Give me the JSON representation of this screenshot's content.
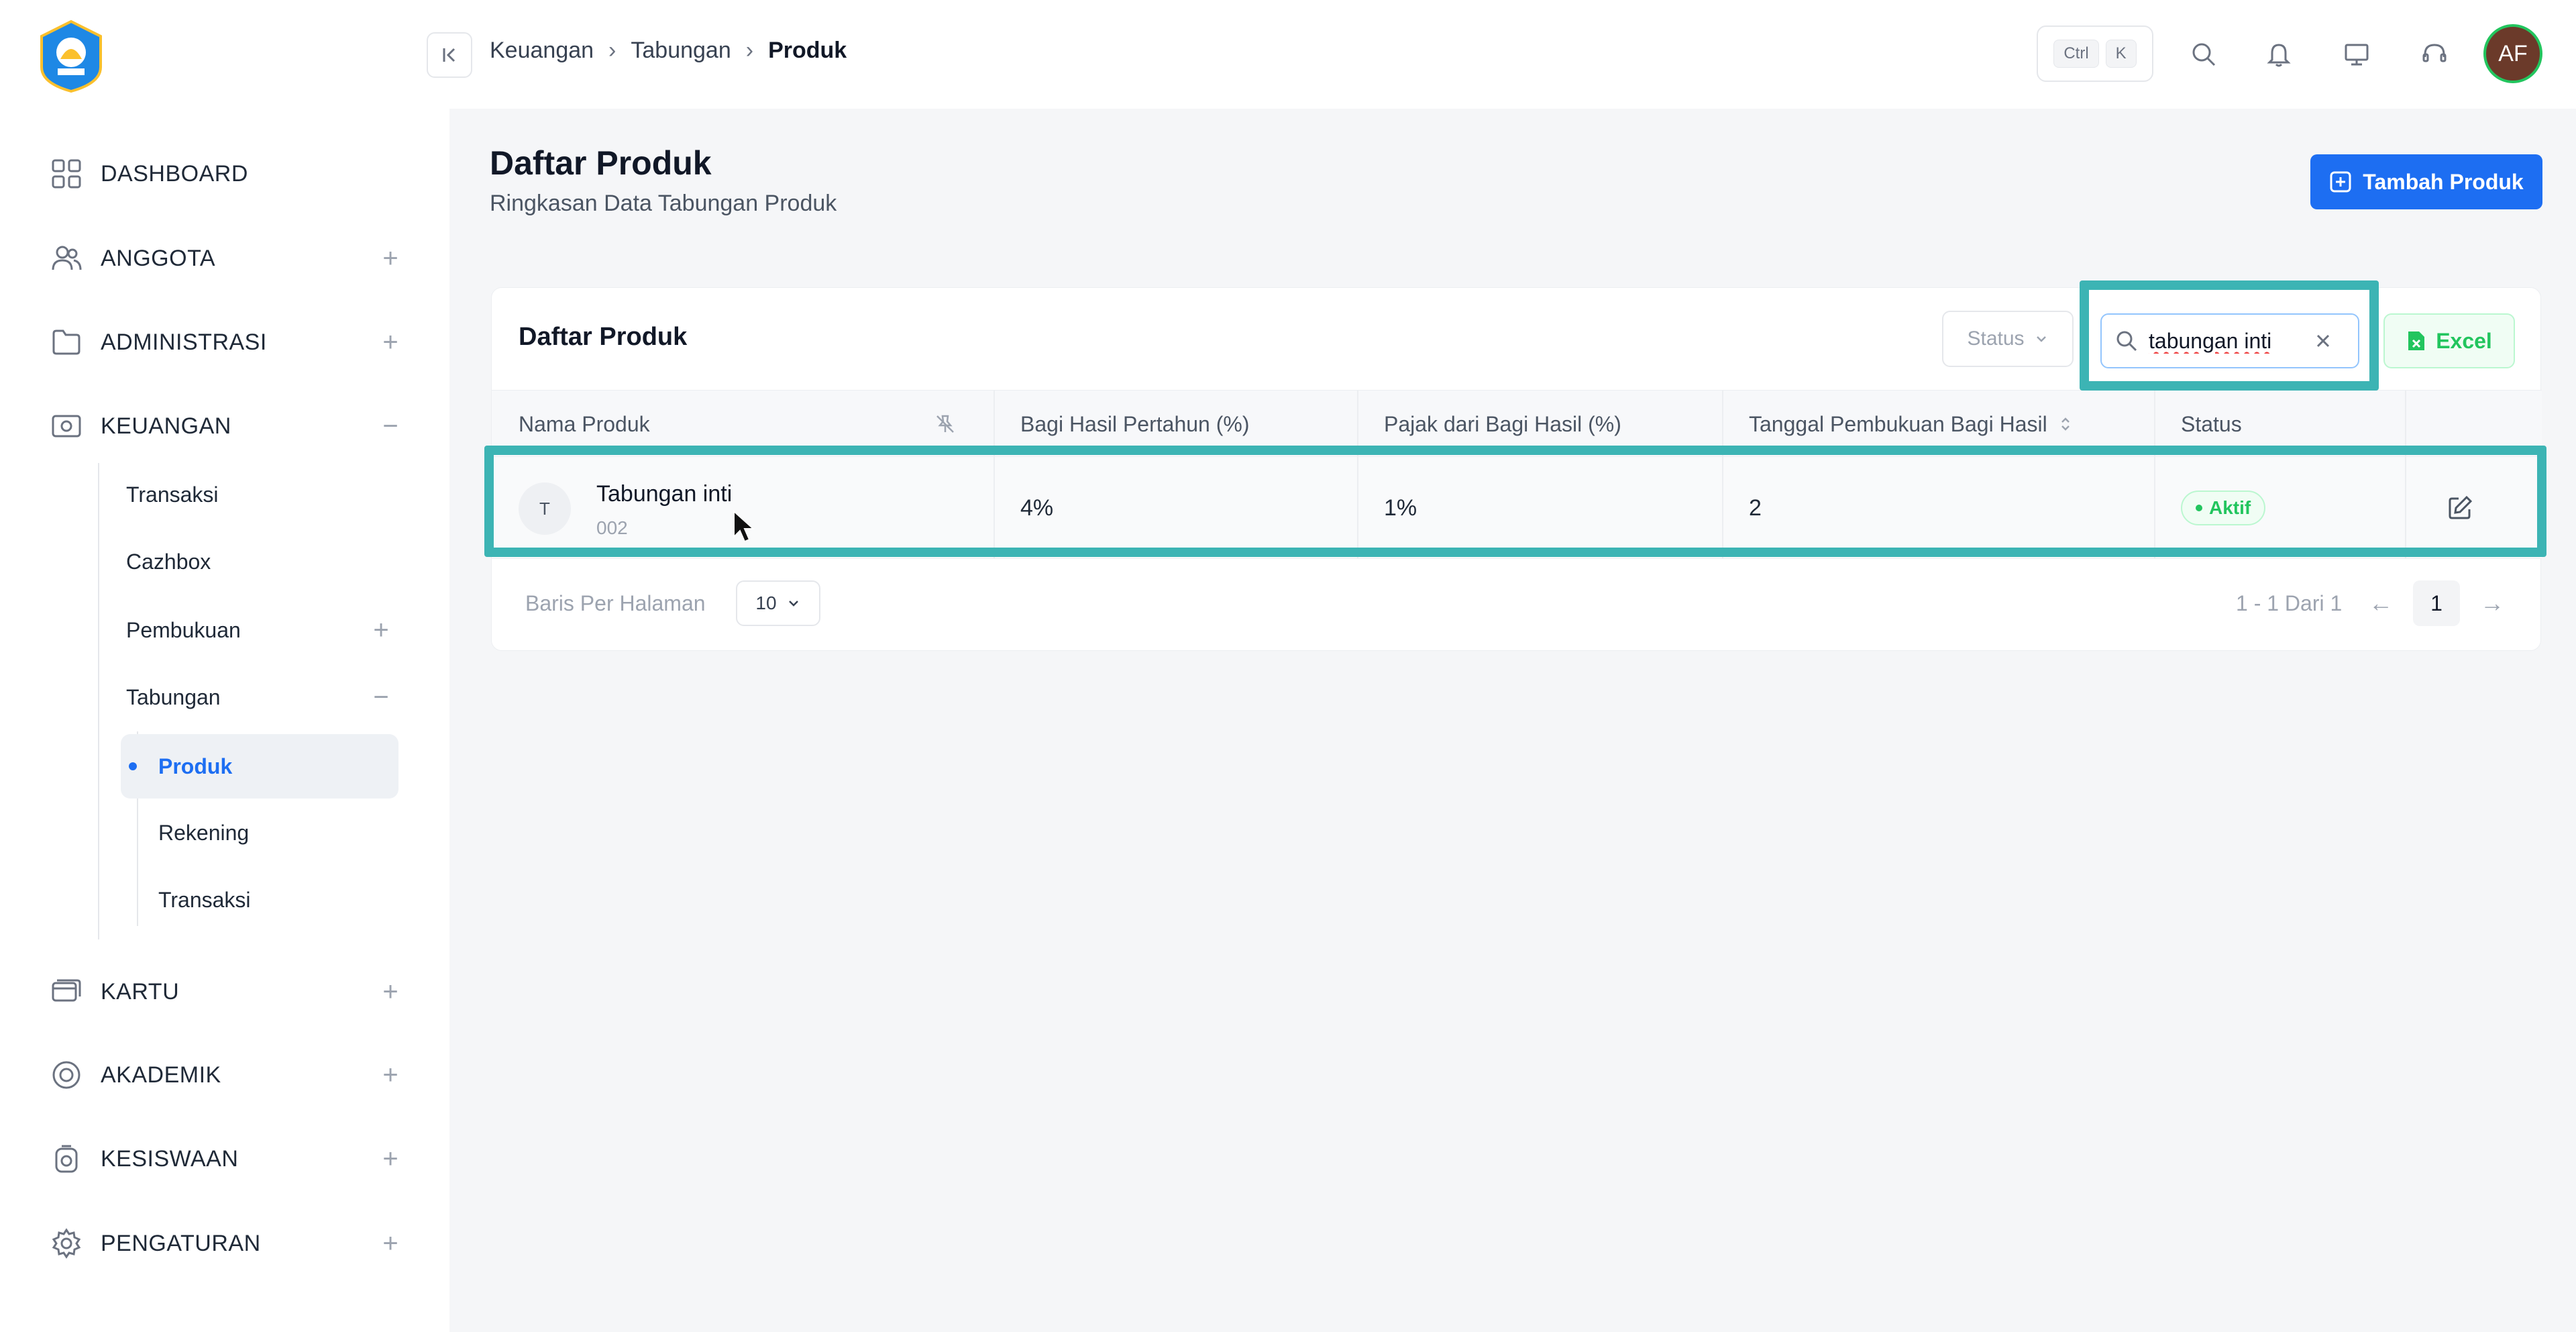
{
  "sidebar": {
    "items": [
      {
        "label": "DASHBOARD",
        "icon": "grid-icon",
        "toggle": ""
      },
      {
        "label": "ANGGOTA",
        "icon": "users-icon",
        "toggle": "+"
      },
      {
        "label": "ADMINISTRASI",
        "icon": "folder-icon",
        "toggle": "+"
      },
      {
        "label": "KEUANGAN",
        "icon": "money-icon",
        "toggle": "−"
      },
      {
        "label": "KARTU",
        "icon": "card-icon",
        "toggle": "+"
      },
      {
        "label": "AKADEMIK",
        "icon": "academic-icon",
        "toggle": "+"
      },
      {
        "label": "KESISWAAN",
        "icon": "student-icon",
        "toggle": "+"
      },
      {
        "label": "PENGATURAN",
        "icon": "gear-icon",
        "toggle": "+"
      }
    ],
    "keuangan_sub": [
      {
        "label": "Transaksi",
        "toggle": ""
      },
      {
        "label": "Cazhbox",
        "toggle": ""
      },
      {
        "label": "Pembukuan",
        "toggle": "+"
      },
      {
        "label": "Tabungan",
        "toggle": "−"
      }
    ],
    "tabungan_sub": [
      {
        "label": "Produk",
        "active": true
      },
      {
        "label": "Rekening",
        "active": false
      },
      {
        "label": "Transaksi",
        "active": false
      }
    ]
  },
  "header": {
    "breadcrumb": [
      "Keuangan",
      "Tabungan",
      "Produk"
    ],
    "shortcut": [
      "Ctrl",
      "K"
    ],
    "avatar_initials": "AF"
  },
  "page": {
    "title": "Daftar Produk",
    "subtitle": "Ringkasan Data Tabungan Produk",
    "add_button": "Tambah Produk"
  },
  "card": {
    "title": "Daftar Produk",
    "status_filter": "Status",
    "search_value": "tabungan inti",
    "excel_button": "Excel",
    "columns": [
      "Nama Produk",
      "Bagi Hasil Pertahun (%)",
      "Pajak dari Bagi Hasil (%)",
      "Tanggal Pembukuan Bagi Hasil",
      "Status"
    ],
    "rows": [
      {
        "initial": "T",
        "name": "Tabungan inti",
        "code": "002",
        "bagi_hasil": "4%",
        "pajak": "1%",
        "tanggal": "2",
        "status": "Aktif"
      }
    ],
    "footer": {
      "per_page_label": "Baris Per Halaman",
      "per_page_value": "10",
      "range": "1 - 1 Dari 1",
      "current_page": "1"
    }
  },
  "colors": {
    "accent": "#1d6ef2",
    "success": "#22c55e",
    "highlight": "#3cb4b4"
  }
}
